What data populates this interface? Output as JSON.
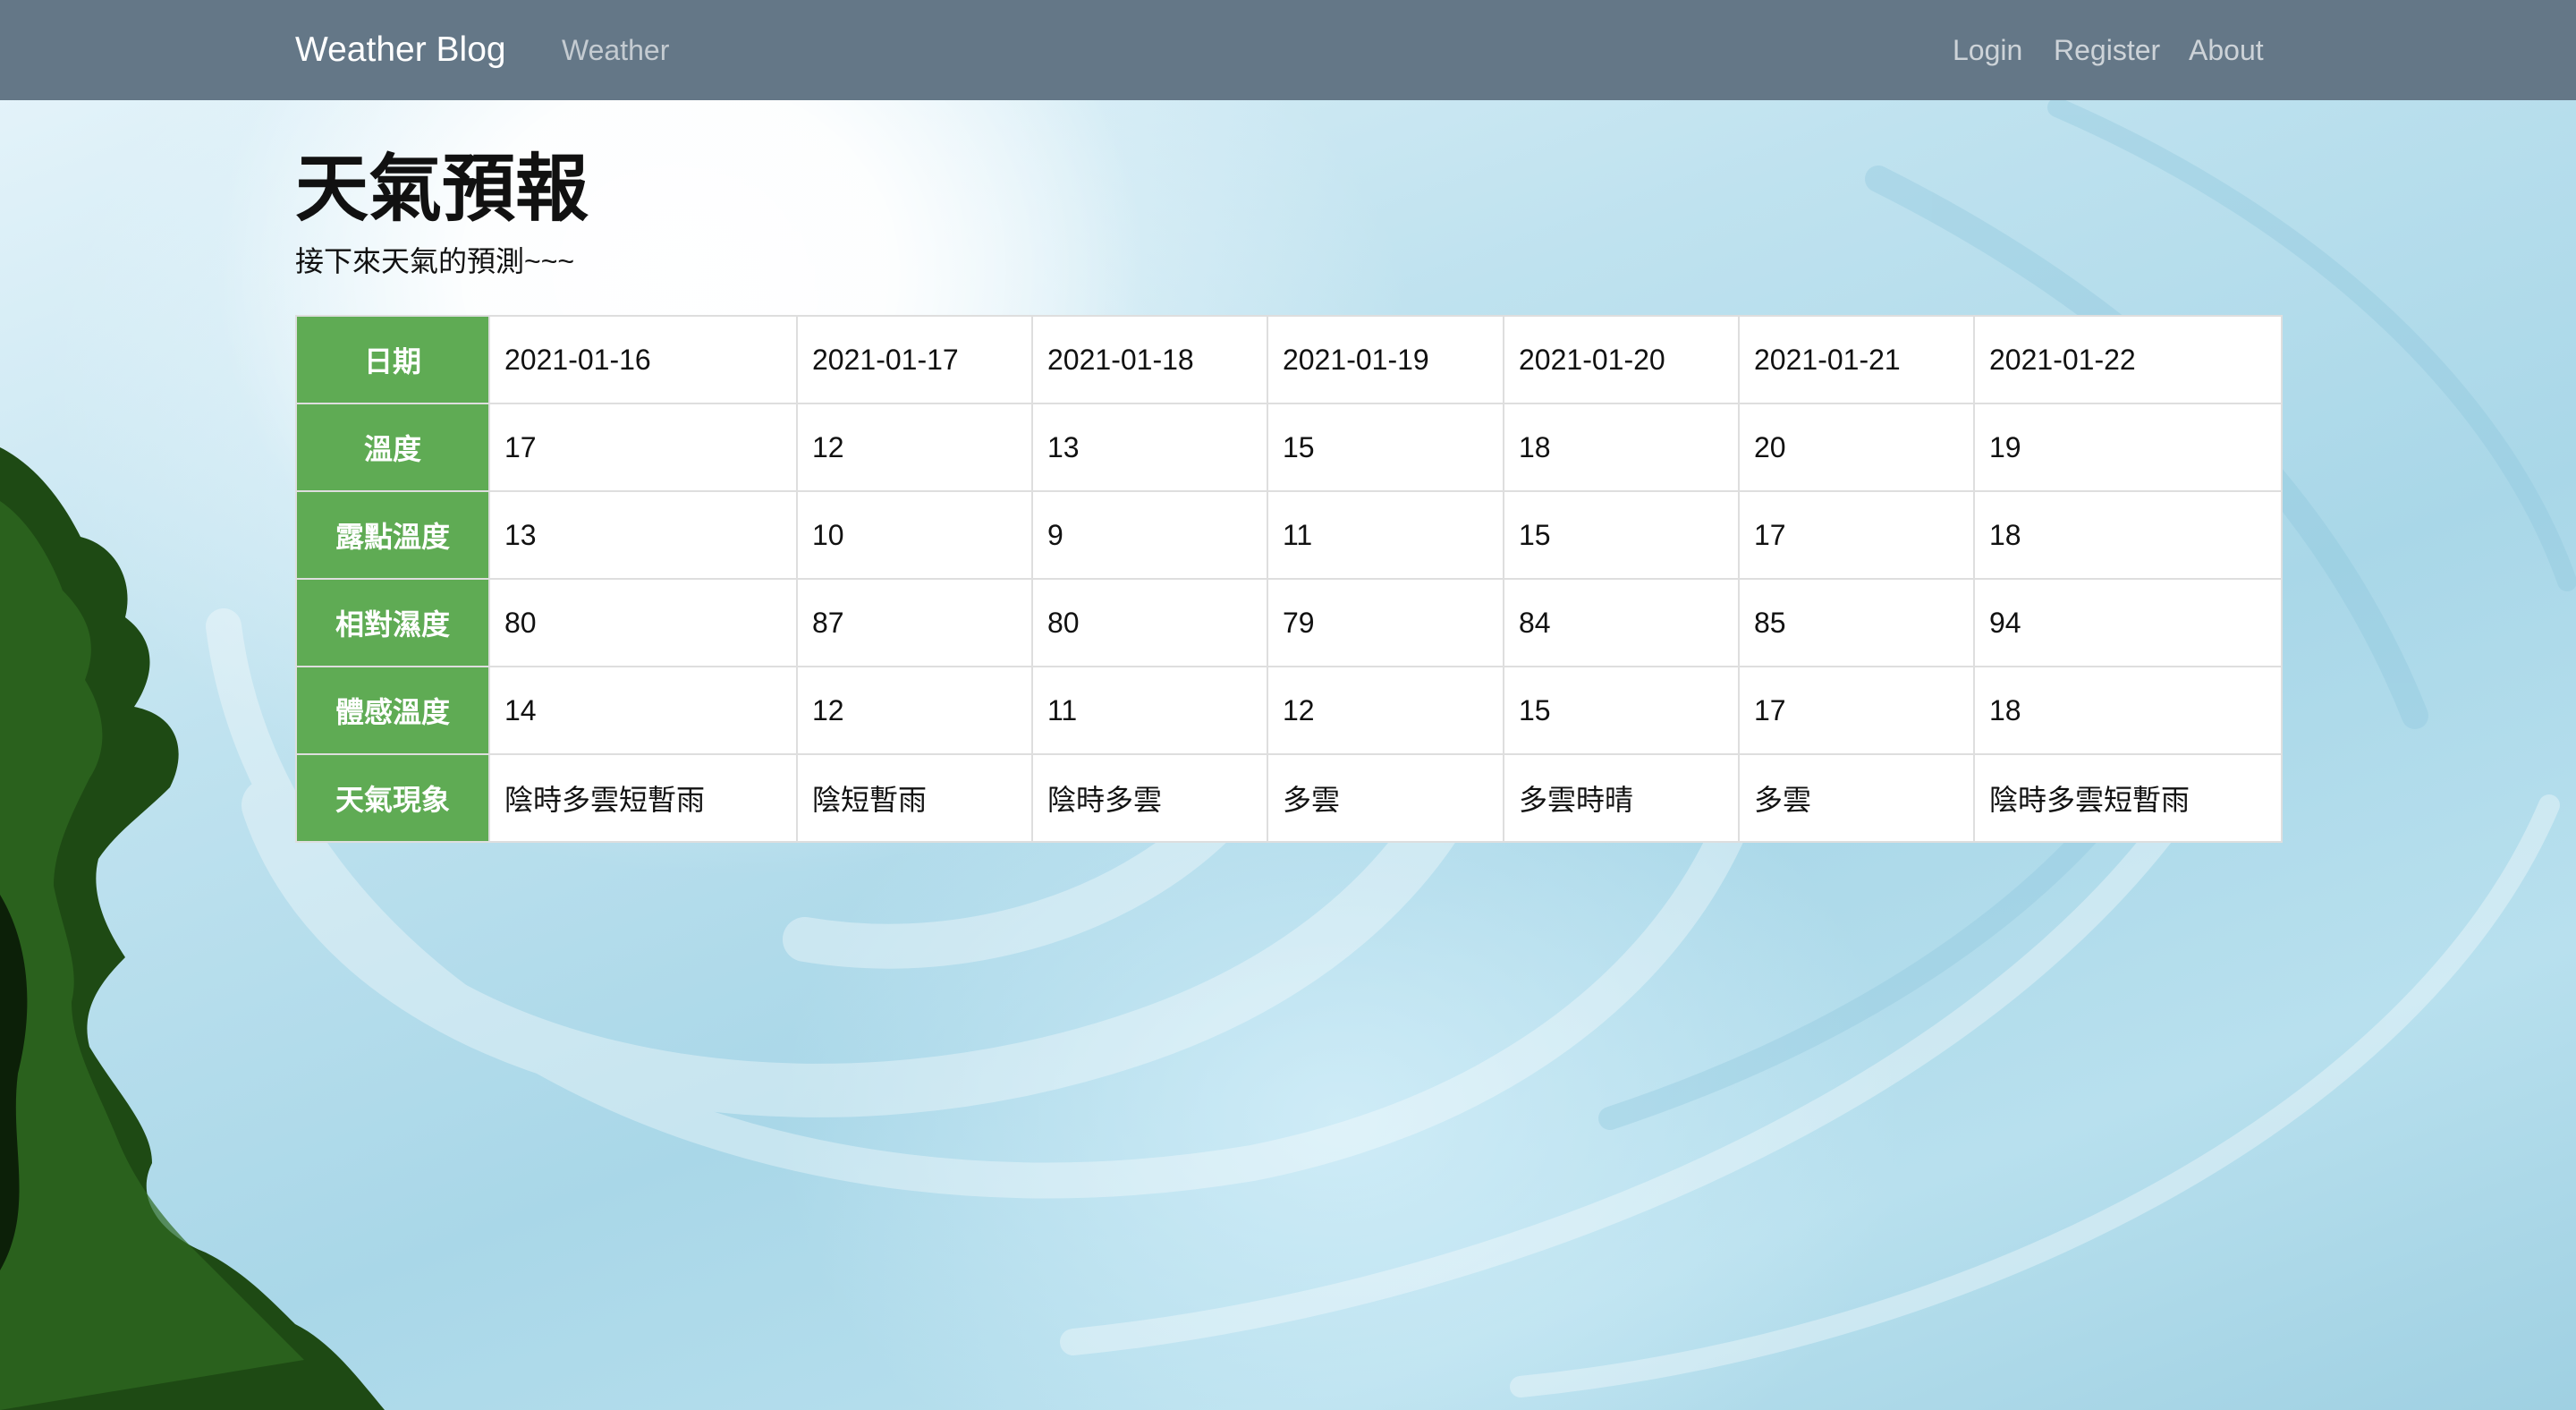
{
  "navbar": {
    "brand": "Weather Blog",
    "weather_link": "Weather",
    "login_link": "Login",
    "register_link": "Register",
    "about_link": "About"
  },
  "page": {
    "title": "天氣預報",
    "subtitle": "接下來天氣的預測~~~"
  },
  "forecast": {
    "rows": [
      {
        "header": "日期",
        "cells": [
          "2021-01-16",
          "2021-01-17",
          "2021-01-18",
          "2021-01-19",
          "2021-01-20",
          "2021-01-21",
          "2021-01-22"
        ]
      },
      {
        "header": "溫度",
        "cells": [
          "17",
          "12",
          "13",
          "15",
          "18",
          "20",
          "19"
        ]
      },
      {
        "header": "露點溫度",
        "cells": [
          "13",
          "10",
          "9",
          "11",
          "15",
          "17",
          "18"
        ]
      },
      {
        "header": "相對濕度",
        "cells": [
          "80",
          "87",
          "80",
          "79",
          "84",
          "85",
          "94"
        ]
      },
      {
        "header": "體感溫度",
        "cells": [
          "14",
          "12",
          "11",
          "12",
          "15",
          "17",
          "18"
        ]
      },
      {
        "header": "天氣現象",
        "cells": [
          "陰時多雲短暫雨",
          "陰短暫雨",
          "陰時多雲",
          "多雲",
          "多雲時晴",
          "多雲",
          "陰時多雲短暫雨"
        ]
      }
    ]
  },
  "colors": {
    "navbar_bg": "#647787",
    "header_cell_bg": "#5fab54",
    "foliage": "#1e4a14"
  },
  "background_image": "swirling sky with trees"
}
